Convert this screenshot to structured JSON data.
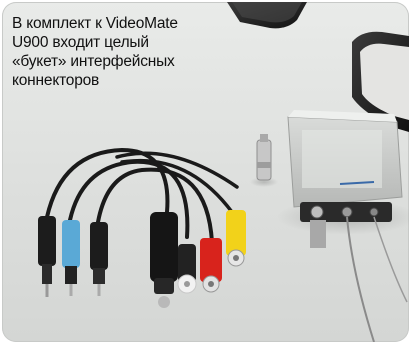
{
  "caption": {
    "lines": [
      "В комплект к VideoMate",
      "U900 входит целый",
      "«букет» интерфейсных",
      "коннекторов"
    ]
  },
  "colors": {
    "background": "#e0e2e0",
    "device_body": "#c9cbc9",
    "cable_black": "#1a1a1a",
    "plug_blue": "#5aa9d6",
    "plug_white": "#f2f2f2",
    "plug_red": "#d8231c",
    "plug_yellow": "#f2d21a"
  },
  "photo": {
    "objects": [
      "breakout-cable",
      "adapter-plug",
      "capture-device",
      "device-corners"
    ]
  }
}
